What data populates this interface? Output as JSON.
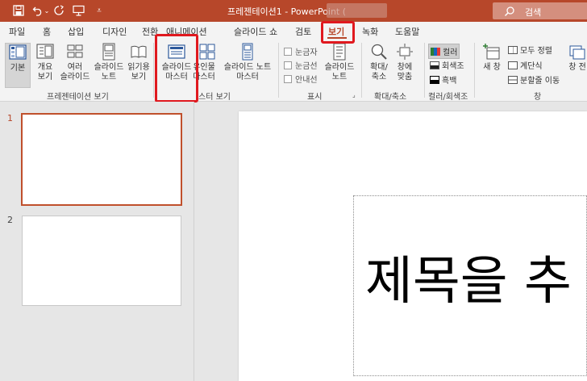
{
  "title_bar": {
    "doc_title": "프레젠테이션1 - PowerPoint (",
    "search_label": "검색"
  },
  "tabs": [
    {
      "label": "파일"
    },
    {
      "label": "홈"
    },
    {
      "label": "삽입"
    },
    {
      "label": "디자인"
    },
    {
      "label": "전환"
    },
    {
      "label": "애니메이션"
    },
    {
      "label": "슬라이드 쇼"
    },
    {
      "label": "검토"
    },
    {
      "label": "보기",
      "active": true
    },
    {
      "label": "녹화"
    },
    {
      "label": "도움말"
    }
  ],
  "ribbon": {
    "presentation_views": {
      "group_label": "프레젠테이션 보기",
      "buttons": [
        {
          "label": "기본"
        },
        {
          "label": "개요\n보기"
        },
        {
          "label": "여러\n슬라이드"
        },
        {
          "label": "슬라이드\n노트"
        },
        {
          "label": "읽기용\n보기"
        }
      ]
    },
    "master_views": {
      "group_label": "스터 보기",
      "buttons": [
        {
          "label": "슬라이드\n마스터"
        },
        {
          "label": "유인물\n마스터"
        },
        {
          "label": "슬라이드 노트\n마스터"
        }
      ]
    },
    "show": {
      "group_label": "표시",
      "checks": [
        {
          "label": "눈금자"
        },
        {
          "label": "눈금선"
        },
        {
          "label": "안내선"
        }
      ],
      "notes_label": "슬라이드\n노트"
    },
    "zoom": {
      "group_label": "확대/축소",
      "buttons": [
        {
          "label": "확대/\n축소"
        },
        {
          "label": "창에\n맞춤"
        }
      ]
    },
    "color": {
      "group_label": "컬러/회색조",
      "items": [
        {
          "label": "컬러"
        },
        {
          "label": "회색조"
        },
        {
          "label": "흑백"
        }
      ]
    },
    "window": {
      "group_label": "창",
      "new_window_label": "새 창",
      "items": [
        {
          "label": "모두 정렬"
        },
        {
          "label": "계단식"
        },
        {
          "label": "분할줄 이동"
        }
      ],
      "switch_label": "창 전"
    }
  },
  "thumbnails": [
    {
      "number": "1"
    },
    {
      "number": "2"
    }
  ],
  "slide": {
    "title_placeholder": "제목을 추"
  },
  "colors": {
    "accent": "#b7472a",
    "highlight": "#e0191f"
  }
}
